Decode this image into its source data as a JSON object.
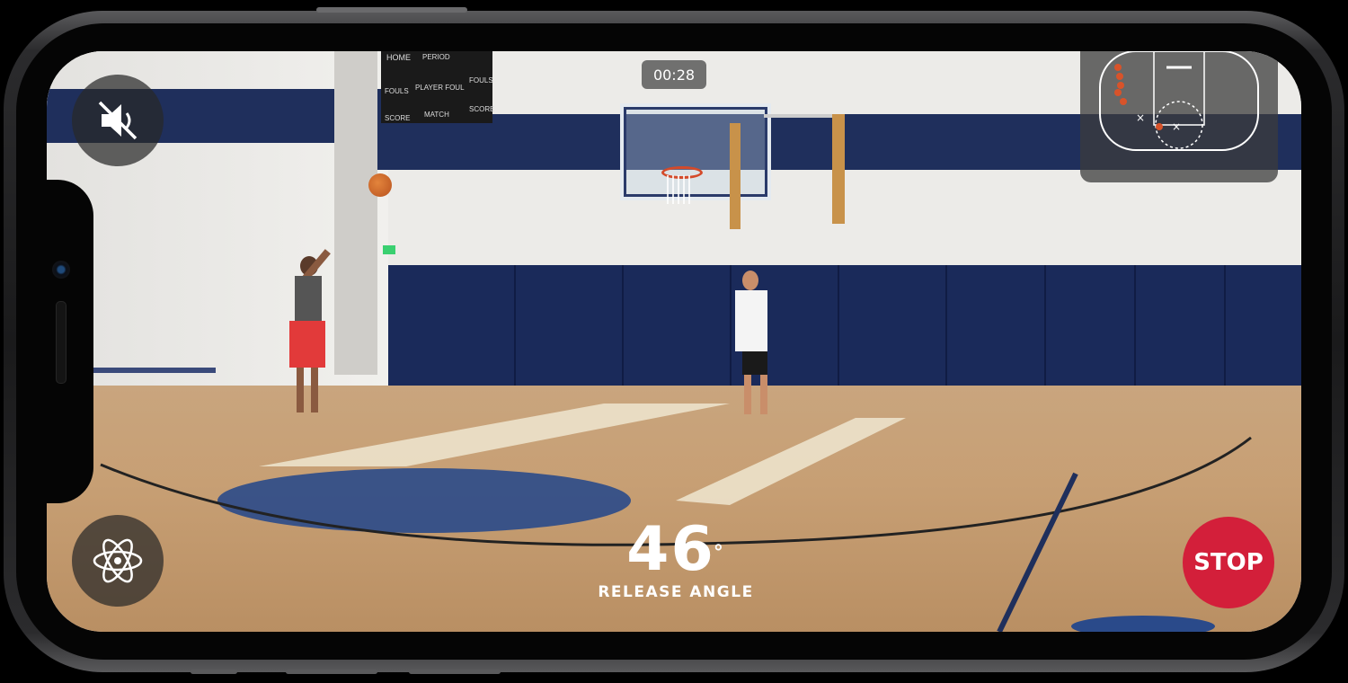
{
  "app": {
    "timer": "00:28",
    "release_angle": {
      "value": "46",
      "unit": "°",
      "label": "RELEASE ANGLE"
    },
    "stop_label": "STOP",
    "mute_icon": "speaker-muted-icon",
    "ar_icon": "atom-icon"
  },
  "scoreboard": {
    "home": "HOME",
    "period": "PERIOD",
    "fouls_left": "FOULS",
    "player_foul": "PLAYER FOUL",
    "fouls_right": "FOULS",
    "score_left": "SCORE",
    "match": "MATCH",
    "score_right": "SCORE"
  },
  "colors": {
    "stop": "#d31f3a",
    "court_blue": "#1f2f5c",
    "made_shot": "#d8532a"
  }
}
